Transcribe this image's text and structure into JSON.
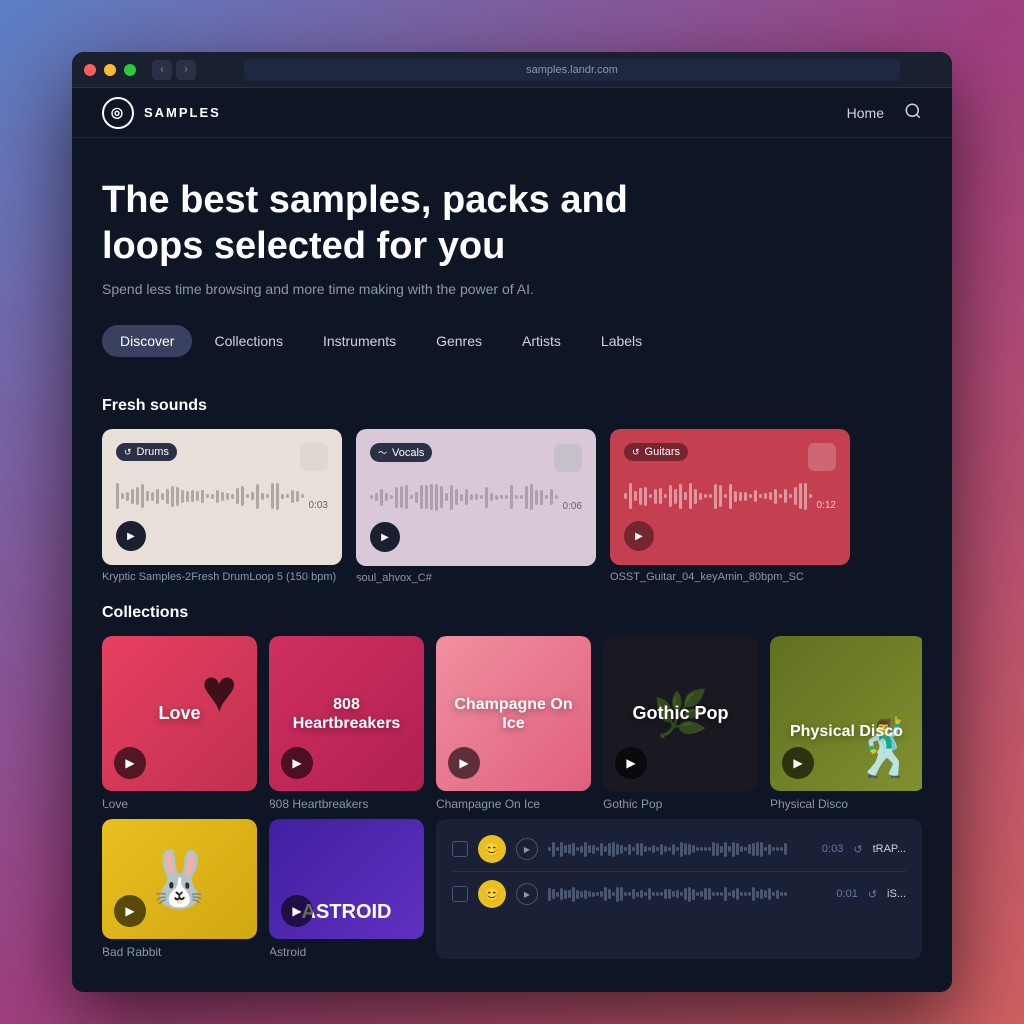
{
  "window": {
    "url": "samples.landr.com"
  },
  "nav": {
    "logo_text": "SAMPLES",
    "home_label": "Home"
  },
  "hero": {
    "title": "The best samples, packs and loops selected for you",
    "subtitle": "Spend less time browsing and more time making with the power of AI."
  },
  "tabs": [
    {
      "id": "discover",
      "label": "Discover",
      "active": true
    },
    {
      "id": "collections",
      "label": "Collections",
      "active": false
    },
    {
      "id": "instruments",
      "label": "Instruments",
      "active": false
    },
    {
      "id": "genres",
      "label": "Genres",
      "active": false
    },
    {
      "id": "artists",
      "label": "Artists",
      "active": false
    },
    {
      "id": "labels",
      "label": "Labels",
      "active": false
    }
  ],
  "fresh_sounds": {
    "section_title": "Fresh sounds",
    "items": [
      {
        "id": "drums",
        "badge": "Drums",
        "time": "0:03",
        "name": "Kryptic Samples-2Fresh DrumLoop 5 (150 bpm)",
        "color": "light"
      },
      {
        "id": "vocals",
        "badge": "Vocals",
        "time": "0:06",
        "name": "soul_ahvox_C#",
        "color": "light"
      },
      {
        "id": "guitars",
        "badge": "Guitars",
        "time": "0:12",
        "name": "OSST_Guitar_04_keyAmin_80bpm_SC",
        "color": "red"
      }
    ]
  },
  "collections": {
    "section_title": "Collections",
    "items": [
      {
        "id": "love",
        "label": "Love",
        "name": "Love",
        "color": "love"
      },
      {
        "id": "heartbreakers",
        "label": "808 Heartbreakers",
        "name": "808 Heartbreakers",
        "color": "heartbreakers"
      },
      {
        "id": "champagne",
        "label": "Champagne On Ice",
        "name": "Champagne On Ice",
        "color": "champagne"
      },
      {
        "id": "gothic",
        "label": "Gothic Pop",
        "name": "Gothic Pop",
        "color": "gothic"
      },
      {
        "id": "physical",
        "label": "Physical Disco",
        "name": "Physical Disco",
        "color": "physical"
      }
    ]
  },
  "bottom_collections": [
    {
      "id": "rabbit",
      "label": "Bad Rabbit",
      "name": "Bad Rabbit",
      "color": "rabbit"
    },
    {
      "id": "astroid",
      "label": "Astroid",
      "name": "Astroid",
      "color": "astroid"
    }
  ],
  "tracks": [
    {
      "id": "t1",
      "time": "0:03",
      "name": "tRAP..."
    },
    {
      "id": "t2",
      "time": "0:01",
      "name": "iS..."
    }
  ]
}
